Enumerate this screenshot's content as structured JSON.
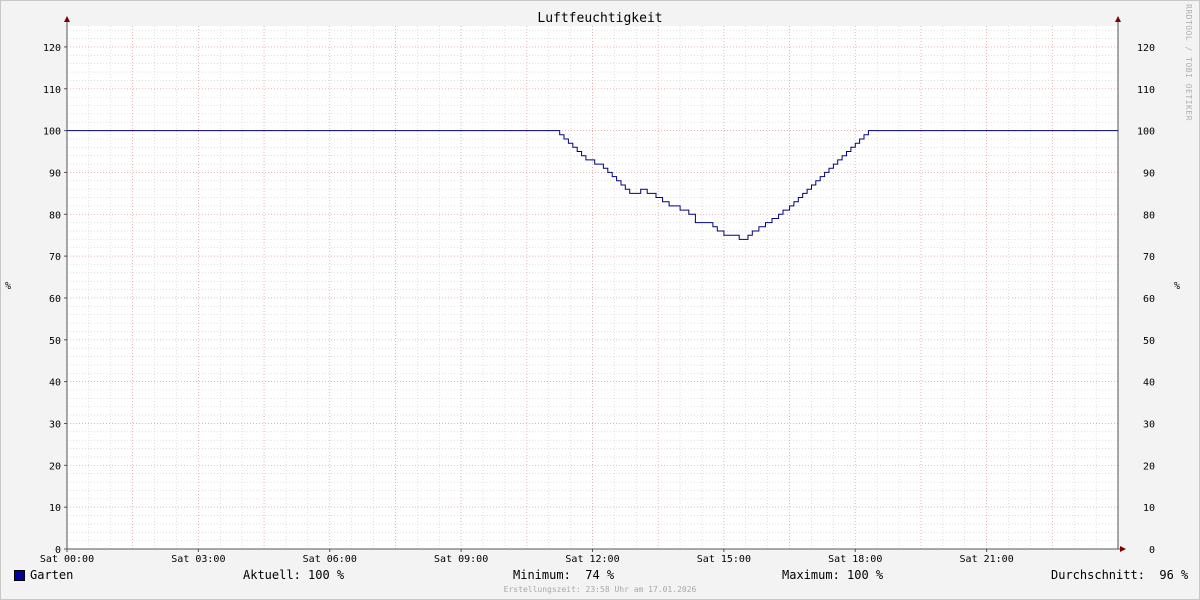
{
  "colors": {
    "background": "#f3f3f3",
    "canvas": "#ffffff",
    "series": "#000080",
    "legend_swatch": "#0000a0",
    "major_grid": "#e6a0a0",
    "minor_grid": "#cccccc",
    "axis_arrow": "#800000"
  },
  "watermark": "RRDTOOL / TOBI OETIKER",
  "legend": {
    "series_name": "Garten",
    "current_label": "Aktuell:",
    "current_value": "100 %",
    "min_label": "Minimum:",
    "min_value": "74 %",
    "max_label": "Maximum:",
    "max_value": "100 %",
    "avg_label": "Durchschnitt:",
    "avg_value": "96 %"
  },
  "footer": "Erstellungszeit: 23:58 Uhr am 17.01.2026",
  "chart_data": {
    "type": "line",
    "title": "Luftfeuchtigkeit",
    "ylabel": "%",
    "ylabel_right": "%",
    "xlim": [
      "00:00",
      "24:00"
    ],
    "ylim": [
      0,
      125
    ],
    "y_ticks": [
      0,
      10,
      20,
      30,
      40,
      50,
      60,
      70,
      80,
      90,
      100,
      110,
      120
    ],
    "x_ticks": [
      {
        "hour": 0,
        "label": "Sat 00:00"
      },
      {
        "hour": 3,
        "label": "Sat 03:00"
      },
      {
        "hour": 6,
        "label": "Sat 06:00"
      },
      {
        "hour": 9,
        "label": "Sat 09:00"
      },
      {
        "hour": 12,
        "label": "Sat 12:00"
      },
      {
        "hour": 15,
        "label": "Sat 15:00"
      },
      {
        "hour": 18,
        "label": "Sat 18:00"
      },
      {
        "hour": 21,
        "label": "Sat 21:00"
      }
    ],
    "grid": true,
    "legend_position": "bottom",
    "series": [
      {
        "name": "Garten",
        "x": [
          0,
          11.2,
          11.25,
          11.35,
          11.45,
          11.55,
          11.65,
          11.75,
          11.85,
          11.95,
          12.05,
          12.15,
          12.25,
          12.35,
          12.45,
          12.55,
          12.65,
          12.75,
          12.85,
          12.95,
          13.0,
          13.1,
          13.25,
          13.45,
          13.6,
          13.75,
          14.0,
          14.2,
          14.35,
          14.75,
          14.85,
          15.0,
          15.2,
          15.35,
          15.45,
          15.55,
          15.65,
          15.8,
          15.95,
          16.1,
          16.25,
          16.35,
          16.5,
          16.6,
          16.7,
          16.8,
          16.9,
          17.0,
          17.1,
          17.2,
          17.3,
          17.4,
          17.5,
          17.6,
          17.7,
          17.8,
          17.9,
          18.0,
          18.1,
          18.2,
          18.3,
          24.0
        ],
        "y": [
          100,
          100,
          99,
          98,
          97,
          96,
          95,
          94,
          93,
          93,
          92,
          92,
          91,
          90,
          89,
          88,
          87,
          86,
          85,
          85,
          85,
          86,
          85,
          84,
          83,
          82,
          81,
          80,
          78,
          77,
          76,
          75,
          75,
          74,
          74,
          75,
          76,
          77,
          78,
          79,
          80,
          81,
          82,
          83,
          84,
          85,
          86,
          87,
          88,
          89,
          90,
          91,
          92,
          93,
          94,
          95,
          96,
          97,
          98,
          99,
          100,
          100
        ]
      }
    ]
  }
}
